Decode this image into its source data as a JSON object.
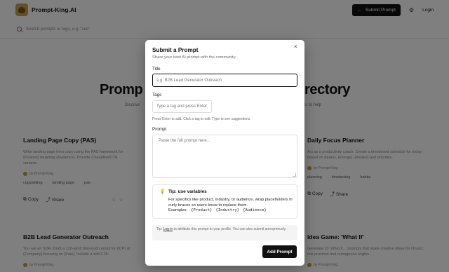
{
  "header": {
    "logo_text": "Prompt-King.AI",
    "submit_label": "Submit Prompt",
    "login_label": "Login",
    "search_placeholder": "Search prompts or tags, e.g. \"seo\""
  },
  "hero": {
    "title_left": "Promp",
    "title_right": "rectory",
    "subtitle_left": "Discove",
    "subtitle_right": "ls to help"
  },
  "cards": [
    {
      "title": "Landing Page Copy (PAS)",
      "desc": "Write landing page hero copy using the PAS framework for {Product} targeting {Audience}. Provide 3 headline/CTA variants.",
      "author": "by Prompt King",
      "tags": [
        "copywriting",
        "landing page",
        "pas"
      ],
      "copy": "Copy",
      "share": "Share"
    },
    {
      "title": "Daily Focus Planner",
      "desc": "Act as a productivity coach. Create a timeboxed schedule for today based on {tasks}, {energy}, {breaks} and priorities.",
      "author": "by Prompt King",
      "tags": [
        "planning",
        "timeboxing",
        "habits"
      ],
      "copy": "Copy",
      "share": "Share"
    },
    {
      "title": "B2B Lead Generator Outreach",
      "desc": "You are an SDR. Draft a 120-word first-touch email for {ICP} at {Company} focusing on {Pain}. Include a soft CTA.",
      "author": "by Prompt King"
    },
    {
      "title": "Idea Game: 'What If'",
      "desc": "Generate 10 'What if...' prompts that spark creative ideas for {Topic}; mix practical and outrageous angles.",
      "author": "by Prompt King"
    }
  ],
  "modal": {
    "title": "Submit a Prompt",
    "subtitle": "Share your best AI prompt with the community.",
    "close": "×",
    "title_label": "Title",
    "title_placeholder": "e.g. B2B Lead Generator Outreach",
    "tags_label": "Tags",
    "tags_placeholder": "Type a tag and press Enter",
    "tags_help": "Press Enter to add. Click a tag to edit. Type to see suggestions.",
    "prompt_label": "Prompt",
    "prompt_placeholder": "Paste the full prompt here...",
    "tip_title": "Tip: use variables",
    "tip_body": "For specifics like product, industry, or audience, wrap placeholders in curly braces so users know to replace them.",
    "tip_examples_label": "Examples:",
    "tip_examples": [
      "{Product}",
      "{Industry}",
      "{Audience}"
    ],
    "bottom_tip_prefix": "Tip:",
    "bottom_tip_link": "Log in",
    "bottom_tip_suffix": "to attribute this prompt to your profile. You can also submit anonymously.",
    "add_button": "Add Prompt"
  }
}
